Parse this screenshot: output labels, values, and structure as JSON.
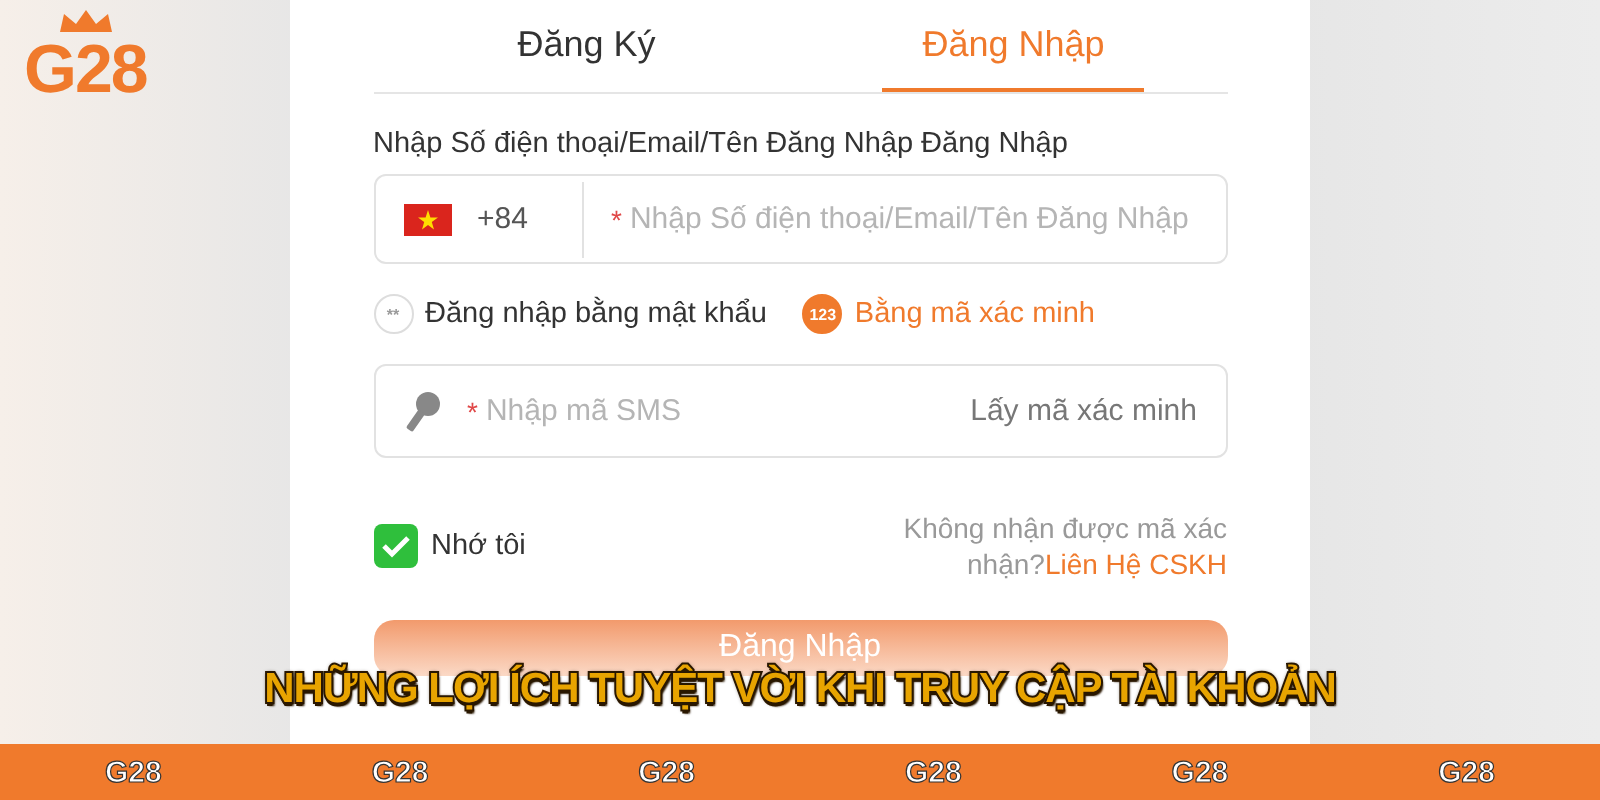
{
  "logo": {
    "text": "G28"
  },
  "tabs": [
    {
      "label": "Đăng Ký",
      "selected": false
    },
    {
      "label": "Đăng Nhập",
      "selected": true
    }
  ],
  "account_label": "Nhập Số điện thoại/Email/Tên Đăng Nhập Đăng Nhập",
  "phone_field": {
    "country_code": "+84",
    "required_mark": "*",
    "placeholder": "Nhập Số điện thoại/Email/Tên Đăng Nhập"
  },
  "login_methods": [
    {
      "icon_text": "**",
      "label": "Đăng nhập bằng mật khẩu",
      "selected": false
    },
    {
      "icon_text": "123",
      "label": "Bằng mã xác minh",
      "selected": true
    }
  ],
  "sms_field": {
    "required_mark": "*",
    "placeholder": "Nhập mã SMS",
    "action": "Lấy mã xác minh"
  },
  "remember": {
    "label": "Nhớ tôi",
    "checked": true
  },
  "help": {
    "text": "Không nhận được mã xác nhận?",
    "link": "Liên Hệ CSKH"
  },
  "submit_button": "Đăng Nhập",
  "headline": "NHỮNG LỢI ÍCH TUYỆT VỜI KHI TRUY CẬP TÀI KHOẢN",
  "footer_marks": [
    "G28",
    "G28",
    "G28",
    "G28",
    "G28",
    "G28"
  ]
}
